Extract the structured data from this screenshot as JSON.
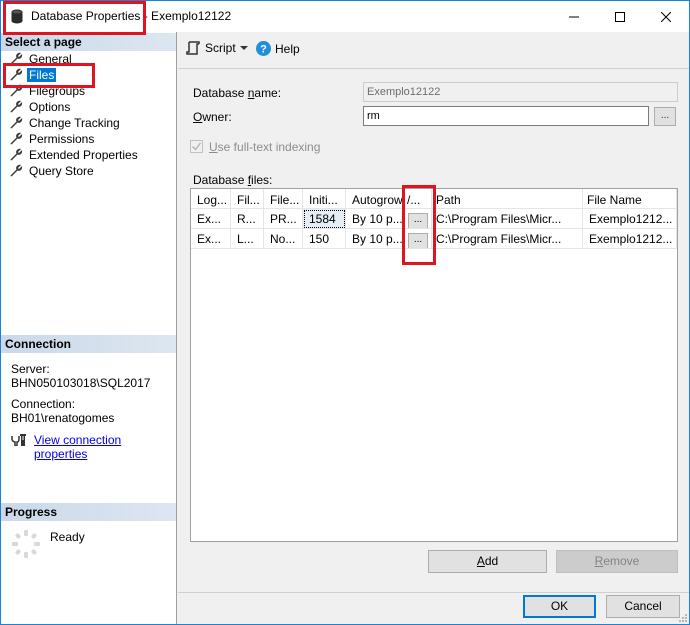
{
  "window": {
    "title": "Database Properties - Exemplo12122",
    "icon": "database-icon",
    "controls": [
      "minimize-icon",
      "maximize-icon",
      "close-icon"
    ]
  },
  "left_pane": {
    "select_page_header": "Select a page",
    "pages": [
      {
        "label": "General",
        "icon": "wrench-icon",
        "selected": false
      },
      {
        "label": "Files",
        "icon": "wrench-icon",
        "selected": true
      },
      {
        "label": "Filegroups",
        "icon": "wrench-icon",
        "selected": false
      },
      {
        "label": "Options",
        "icon": "wrench-icon",
        "selected": false
      },
      {
        "label": "Change Tracking",
        "icon": "wrench-icon",
        "selected": false
      },
      {
        "label": "Permissions",
        "icon": "wrench-icon",
        "selected": false
      },
      {
        "label": "Extended Properties",
        "icon": "wrench-icon",
        "selected": false
      },
      {
        "label": "Query Store",
        "icon": "wrench-icon",
        "selected": false
      }
    ],
    "connection": {
      "header": "Connection",
      "server_label": "Server:",
      "server_value": "BHN050103018\\SQL2017",
      "connection_label": "Connection:",
      "connection_value": "BH01\\renatogomes",
      "view_link": "View connection properties"
    },
    "progress": {
      "header": "Progress",
      "status": "Ready"
    }
  },
  "toolbar": {
    "script_label": "Script",
    "help_label": "Help"
  },
  "form": {
    "database_name_label_pre": "Database ",
    "database_name_label_u": "n",
    "database_name_label_post": "ame:",
    "database_name_value": "Exemplo12122",
    "owner_label_u": "O",
    "owner_label_post": "wner:",
    "owner_value": "rm",
    "owner_browse": "...",
    "fulltext_u": "U",
    "fulltext_post": "se full-text indexing",
    "fulltext_checked": true,
    "database_files_label_pre": "Database ",
    "database_files_label_u": "f",
    "database_files_label_post": "iles:"
  },
  "files_grid": {
    "columns": [
      "Log...",
      "Fil...",
      "File...",
      "Initi...",
      "Autogrowth",
      "/...",
      "Path",
      "File Name"
    ],
    "rows": [
      [
        "Ex...",
        "R...",
        "PR...",
        "1584",
        "By 10 p...",
        "...",
        "C:\\Program Files\\Micr...",
        "Exemplo1212..."
      ],
      [
        "Ex...",
        "L...",
        "No...",
        "150",
        "By 10 p...",
        "...",
        "C:\\Program Files\\Micr...",
        "Exemplo1212..."
      ]
    ]
  },
  "buttons": {
    "add_u": "A",
    "add_post": "dd",
    "remove_u": "R",
    "remove_post": "emove",
    "ok": "OK",
    "cancel": "Cancel"
  },
  "colors": {
    "highlight": "#e0141e",
    "selection": "#0078d7",
    "link": "#0000ee"
  }
}
